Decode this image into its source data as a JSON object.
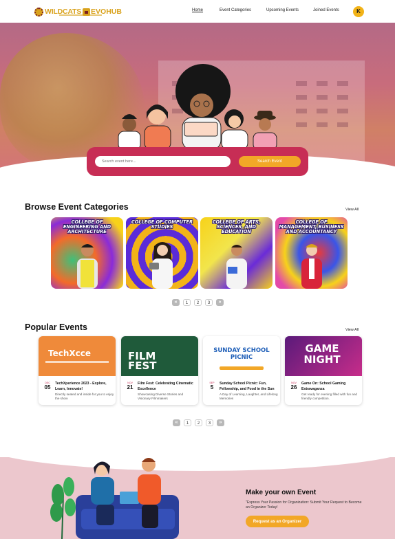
{
  "nav": {
    "logo_part1": "WILDCATS",
    "logo_part2": "EVOHUB",
    "links": [
      "Home",
      "Event Categories",
      "Upcoming Events",
      "Joined Events"
    ],
    "avatar_initial": "K"
  },
  "hero": {
    "search_placeholder": "Search event here...",
    "search_button": "Search Event"
  },
  "categories": {
    "title": "Browse Event Categories",
    "view_all": "View All",
    "items": [
      {
        "label": "College of Engineering and Architecture",
        "icon": "engineer-illustration"
      },
      {
        "label": "College of Computer Studies",
        "icon": "student-tablet-illustration"
      },
      {
        "label": "College of Arts, Sciences, and Education",
        "icon": "student-books-illustration"
      },
      {
        "label": "College of Management, Business and Accountancy",
        "icon": "student-blazer-illustration"
      }
    ],
    "pager": [
      "1",
      "2",
      "3"
    ]
  },
  "events": {
    "title": "Popular Events",
    "view_all": "View All",
    "items": [
      {
        "month": "DEC",
        "day": "05",
        "title": "TechXperience 2023 - Explore, Learn, Innovate!",
        "desc": "Directly seated and inside for you to enjoy the show",
        "image_text": "TechXcce"
      },
      {
        "month": "NOV",
        "day": "21",
        "title": "Film Fest: Celebrating Cinematic Excellence",
        "desc": "Showcasing Diverse Stories and Visionary Filmmakers",
        "image_text": "FILM FEST"
      },
      {
        "month": "SEP",
        "day": "5",
        "title": "Sunday School Picnic: Fun, Fellowship, and Food in the Sun",
        "desc": "A Day of Learning, Laughter, and Lifelong Memories",
        "image_text": "SUNDAY SCHOOL PICNIC"
      },
      {
        "month": "NOV",
        "day": "26",
        "title": "Game On: School Gaming Extravaganza",
        "desc": "Get ready for evening filled with fun and friendly competition.",
        "image_text": "GAME NIGHT"
      }
    ],
    "pager": [
      "1",
      "2",
      "3"
    ]
  },
  "organizer": {
    "title": "Make your own Event",
    "desc": "\"Express Your Passion for Organization: Submit Your Request to Become an Organizer Today!",
    "button": "Request as an Organizer"
  },
  "colors": {
    "brand_gold": "#d9a21c",
    "brand_maroon": "#7a1e1e",
    "accent_pink": "#c72d55",
    "accent_orange": "#f2a727",
    "band_pink": "#ecc7cd"
  }
}
